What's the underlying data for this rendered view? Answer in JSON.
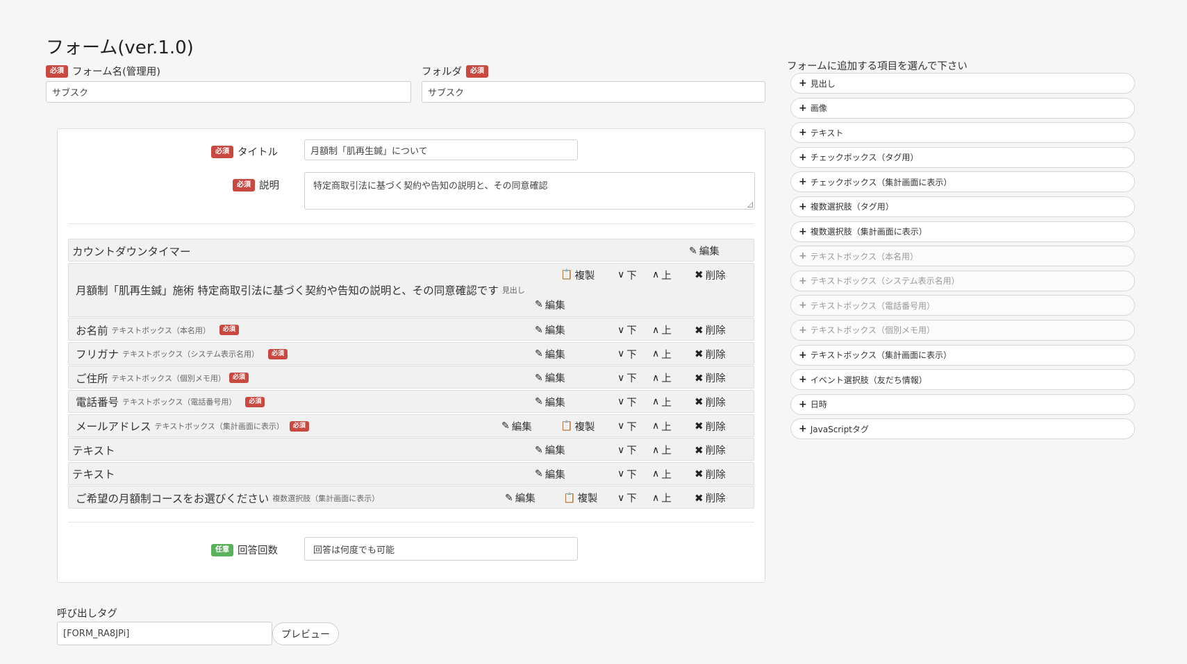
{
  "page_title": "フォーム(ver.1.0)",
  "form_name": {
    "badge": "必須",
    "label": "フォーム名(管理用)",
    "value": "サブスク"
  },
  "folder": {
    "label": "フォルダ",
    "badge": "必須",
    "value": "サブスク"
  },
  "panel": {
    "title_field": {
      "badge": "必須",
      "label": "タイトル",
      "value": "月額制「肌再生鍼」について"
    },
    "desc_field": {
      "badge": "必須",
      "label": "説明",
      "value": "特定商取引法に基づく契約や告知の説明と、その同意確認"
    },
    "answer_count": {
      "badge": "任意",
      "label": "回答回数",
      "value": "回答は何度でも可能"
    }
  },
  "actions": {
    "edit": "編集",
    "copy": "複製",
    "down": "下",
    "up": "上",
    "delete": "削除"
  },
  "items": [
    {
      "title": "カウントダウンタイマー",
      "type": "",
      "badge": ""
    },
    {
      "title": "月額制「肌再生鍼」施術 特定商取引法に基づく契約や告知の説明と、その同意確認です",
      "type": "見出し",
      "badge": ""
    },
    {
      "title": "お名前",
      "type": "テキストボックス（本名用）",
      "badge": "必須"
    },
    {
      "title": "フリガナ",
      "type": "テキストボックス（システム表示名用）",
      "badge": "必須"
    },
    {
      "title": "ご住所",
      "type": "テキストボックス（個別メモ用）",
      "badge": "必須"
    },
    {
      "title": "電話番号",
      "type": "テキストボックス（電話番号用）",
      "badge": "必須"
    },
    {
      "title": "メールアドレス",
      "type": "テキストボックス（集計画面に表示）",
      "badge": "必須"
    },
    {
      "title": "テキスト",
      "type": "",
      "badge": ""
    },
    {
      "title": "テキスト",
      "type": "",
      "badge": ""
    },
    {
      "title": "ご希望の月額制コースをお選びください",
      "type": "複数選択肢（集計画面に表示）",
      "badge": ""
    }
  ],
  "sidebar": {
    "title": "フォームに追加する項目を選んで下さい",
    "items": [
      {
        "label": "見出し"
      },
      {
        "label": "画像"
      },
      {
        "label": "テキスト"
      },
      {
        "label": "チェックボックス（タグ用）"
      },
      {
        "label": "チェックボックス（集計画面に表示）"
      },
      {
        "label": "複数選択肢（タグ用）"
      },
      {
        "label": "複数選択肢（集計画面に表示）"
      },
      {
        "label": "テキストボックス（本名用）"
      },
      {
        "label": "テキストボックス（システム表示名用）"
      },
      {
        "label": "テキストボックス（電話番号用）"
      },
      {
        "label": "テキストボックス（個別メモ用）"
      },
      {
        "label": "テキストボックス（集計画面に表示）"
      },
      {
        "label": "イベント選択肢（友だち情報）"
      },
      {
        "label": "日時"
      },
      {
        "label": "JavaScriptタグ"
      }
    ]
  },
  "call_tag": {
    "label": "呼び出しタグ",
    "value": "[FORM_RA8JPi]",
    "preview": "プレビュー"
  }
}
